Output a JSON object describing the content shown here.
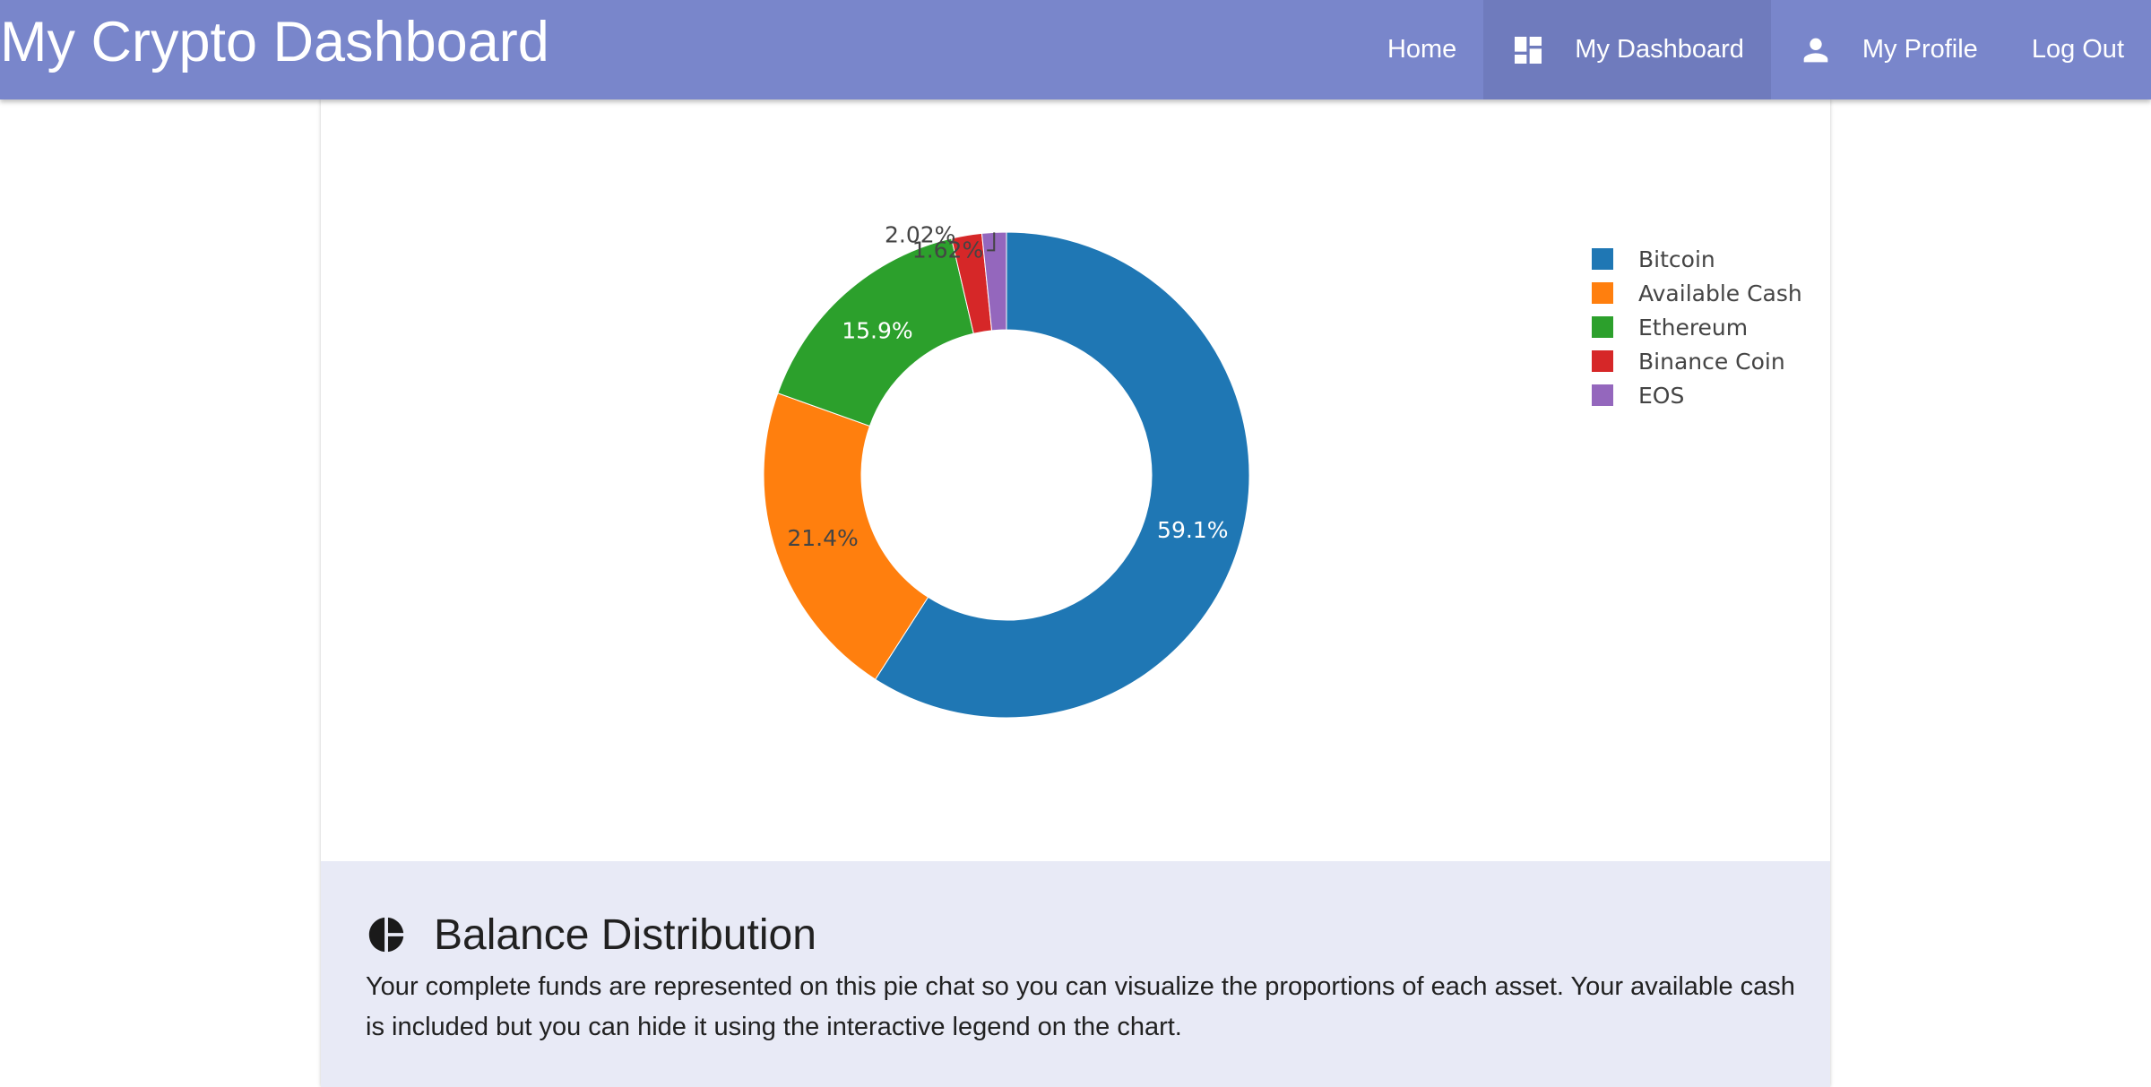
{
  "header": {
    "title": "My Crypto Dashboard",
    "nav": [
      {
        "label": "Home",
        "icon": "",
        "active": false
      },
      {
        "label": "My Dashboard",
        "icon": "dashboard-icon",
        "active": true
      },
      {
        "label": "My Profile",
        "icon": "person-icon",
        "active": false
      },
      {
        "label": "Log Out",
        "icon": "",
        "active": false
      }
    ],
    "color": "#7986cb"
  },
  "chart_data": {
    "type": "pie",
    "hole": true,
    "categories": [
      "Bitcoin",
      "Available Cash",
      "Ethereum",
      "Binance Coin",
      "EOS"
    ],
    "values": [
      59.1,
      21.4,
      15.9,
      2.02,
      1.62
    ],
    "labels": [
      "59.1%",
      "21.4%",
      "15.9%",
      "2.02%",
      "1.62%"
    ],
    "colors": [
      "#1f77b4",
      "#ff7f0e",
      "#2ca02c",
      "#d62728",
      "#9467bd"
    ],
    "legend": "right"
  },
  "info": {
    "title": "Balance Distribution",
    "icon": "pie-chart-icon",
    "description": "Your complete funds are represented on this pie chat so you can visualize the proportions of each asset. Your available cash is included but you can hide it using the interactive legend on the chart."
  }
}
